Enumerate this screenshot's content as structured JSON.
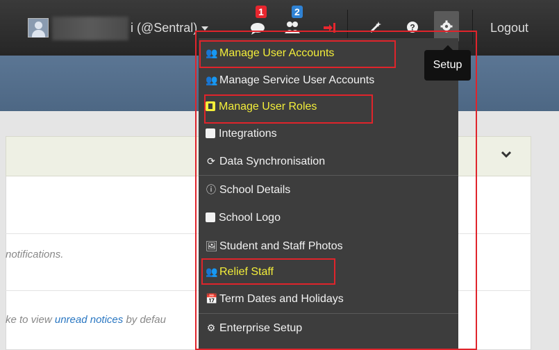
{
  "navbar": {
    "user_label": "i (@Sentral)",
    "messages_badge": "1",
    "users_badge": "2",
    "logout_label": "Logout"
  },
  "tooltip": {
    "label": "Setup"
  },
  "content": {
    "notifications_text": "notifications.",
    "unread_prefix": "ke to view ",
    "unread_link": "unread notices",
    "unread_suffix": " by defau"
  },
  "setup_menu": {
    "items": [
      {
        "label": "Manage User Accounts",
        "icon": "users-icon",
        "highlighted": true
      },
      {
        "label": "Manage Service User Accounts",
        "icon": "users-icon",
        "highlighted": false
      },
      {
        "label": "Manage User Roles",
        "icon": "id-badge-icon",
        "highlighted": true
      },
      {
        "label": "Integrations",
        "icon": "plug-icon",
        "highlighted": false
      },
      {
        "label": "Data Synchronisation",
        "icon": "refresh-icon",
        "highlighted": false
      },
      {
        "label": "School Details",
        "icon": "info-circle-icon",
        "highlighted": false
      },
      {
        "label": "School Logo",
        "icon": "square-icon",
        "highlighted": false
      },
      {
        "label": "Student and Staff Photos",
        "icon": "image-icon",
        "highlighted": false
      },
      {
        "label": "Relief Staff",
        "icon": "users-icon",
        "highlighted": true
      },
      {
        "label": "Term Dates and Holidays",
        "icon": "calendar-icon",
        "highlighted": false
      },
      {
        "label": "Enterprise Setup",
        "icon": "cogs-icon",
        "highlighted": false
      }
    ]
  },
  "colors": {
    "highlight_text": "#f3ee3a",
    "annotation_red": "#e0242b",
    "menu_bg": "#3d3d3d"
  }
}
